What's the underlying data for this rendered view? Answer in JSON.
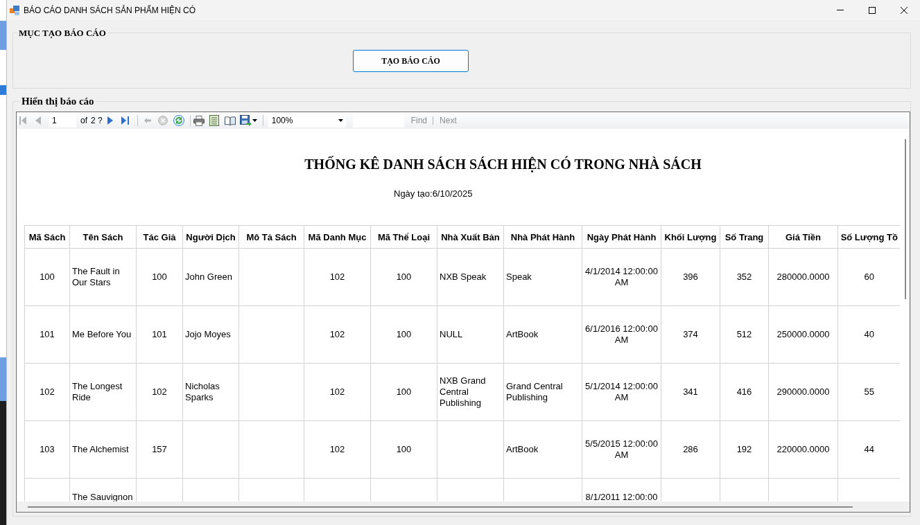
{
  "window": {
    "title": "BÁO CÁO DANH SÁCH SẢN PHẨM HIỆN CÓ"
  },
  "create_group": {
    "legend": "MỤC TẠO BÁO CÁO",
    "button": {
      "label": "TẠO BÁO CÁO",
      "focused": true
    }
  },
  "display_group": {
    "legend": "Hiển thị báo cáo"
  },
  "toolbar": {
    "first_page": {
      "disabled": true
    },
    "previous_page": {
      "disabled": true
    },
    "page_number": "1",
    "page_of": "of",
    "page_count": "2 ?",
    "next_page": {
      "disabled": false
    },
    "last_page": {
      "disabled": false
    },
    "back": {
      "disabled": true
    },
    "stop": {
      "disabled": true
    },
    "refresh": {
      "disabled": false
    },
    "zoom": "100%",
    "find": {
      "label": "Find",
      "disabled": true
    },
    "find_next": {
      "label": "Next",
      "disabled": true
    }
  },
  "report": {
    "title": "THỐNG KÊ DANH SÁCH SÁCH HIỆN CÓ TRONG NHÀ SÁCH",
    "date": "Ngày tạo:6/10/2025",
    "table": {
      "columns": [
        "Mã Sách",
        "Tên Sách",
        "Tác Giả",
        "Người Dịch",
        "Mô Tả Sách",
        "Mã Danh Mục",
        "Mã Thể Loại",
        "Nhà Xuất Bản",
        "Nhà Phát Hành",
        "Ngày Phát Hành",
        "Khối Lượng",
        "Số Trang",
        "Giá Tiền",
        "Số Lượng Tồ"
      ],
      "rows": [
        [
          "100",
          "The Fault in Our Stars",
          "100",
          "John Green",
          null,
          "102",
          "100",
          "NXB Speak",
          "Speak",
          "4/1/2014 12:00:00 AM",
          "396",
          "352",
          "280000.0000",
          "60"
        ],
        [
          "101",
          "Me Before You",
          "101",
          "Jojo Moyes",
          null,
          "102",
          "100",
          "NULL",
          "ArtBook",
          "6/1/2016 12:00:00 AM",
          "374",
          "512",
          "250000.0000",
          "40"
        ],
        [
          "102",
          "The Longest Ride",
          "102",
          "Nicholas Sparks",
          null,
          "102",
          "100",
          "NXB Grand Central Publishing",
          "Grand Central Publishing",
          "5/1/2014 12:00:00 AM",
          "341",
          "416",
          "290000.0000",
          "55"
        ],
        [
          "103",
          "The Alchemist",
          "157",
          null,
          null,
          "102",
          "100",
          null,
          "ArtBook",
          "5/5/2015 12:00:00 AM",
          "286",
          "192",
          "220000.0000",
          "44"
        ],
        [
          null,
          "The Sauvignon",
          null,
          null,
          null,
          null,
          null,
          null,
          null,
          "8/1/2011 12:00:00",
          null,
          null,
          null,
          null
        ]
      ]
    }
  }
}
